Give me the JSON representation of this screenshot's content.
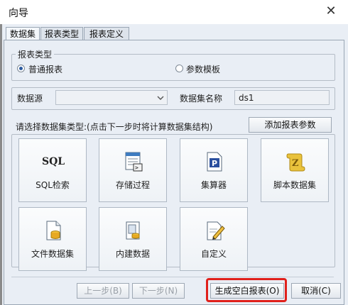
{
  "window": {
    "title": "向导",
    "close_glyph": "✕"
  },
  "tabs": [
    {
      "label": "数据集",
      "active": true
    },
    {
      "label": "报表类型",
      "active": false
    },
    {
      "label": "报表定义",
      "active": false
    }
  ],
  "report_type": {
    "group_label": "报表类型",
    "options": [
      {
        "label": "普通报表",
        "selected": true
      },
      {
        "label": "参数模板",
        "selected": false
      }
    ]
  },
  "datasource": {
    "label": "数据源",
    "value": "",
    "dropdown_icon": "chevron-down-icon"
  },
  "dataset_name": {
    "label": "数据集名称",
    "value": "ds1"
  },
  "dataset_types": {
    "prompt": "请选择数据集类型:(点击下一步时将计算数据集结构)",
    "add_param_button": "添加报表参数",
    "items": [
      {
        "label": "SQL检索",
        "icon": "sql-icon",
        "icon_text": "SQL"
      },
      {
        "label": "存储过程",
        "icon": "stored-procedure-icon",
        "icon_text": ""
      },
      {
        "label": "集算器",
        "icon": "esproc-icon",
        "icon_text": "P"
      },
      {
        "label": "脚本数据集",
        "icon": "script-scroll-icon",
        "icon_text": "Z"
      },
      {
        "label": "文件数据集",
        "icon": "file-dataset-icon",
        "icon_text": ""
      },
      {
        "label": "内建数据",
        "icon": "builtin-data-icon",
        "icon_text": ""
      },
      {
        "label": "自定义",
        "icon": "custom-edit-icon",
        "icon_text": ""
      }
    ]
  },
  "footer": {
    "prev": "上一步(B)",
    "next": "下一步(N)",
    "create_blank": "生成空白报表(O)",
    "cancel": "取消(C)"
  },
  "colors": {
    "highlight": "#e0201b",
    "accent": "#2b5aa0"
  }
}
